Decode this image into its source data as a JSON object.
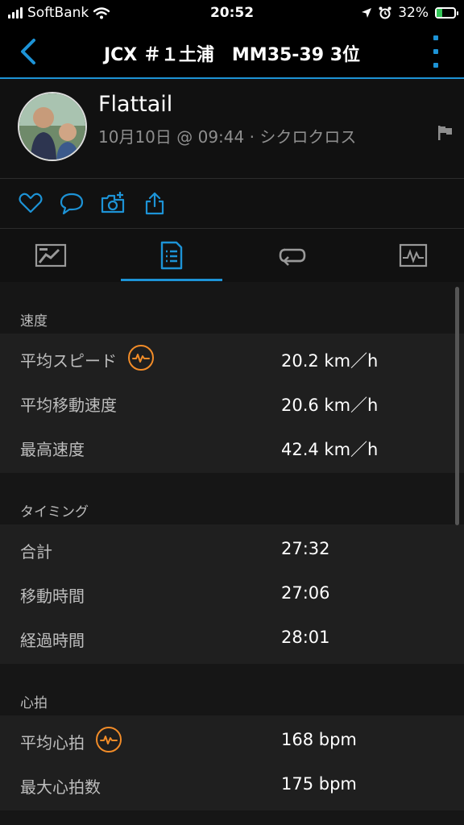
{
  "status_bar": {
    "carrier": "SoftBank",
    "time": "20:52",
    "battery": "32%",
    "battery_level": 0.32
  },
  "header": {
    "title": "JCX ＃１土浦　MM35-39 3位"
  },
  "profile": {
    "name": "Flattail",
    "meta": "10月10日 @ 09:44 · シクロクロス"
  },
  "colors": {
    "accent": "#1d93d6",
    "hr_badge": "#f28c28"
  },
  "sections": [
    {
      "title": "速度",
      "rows": [
        {
          "label": "平均スピード",
          "value": "20.2 km／h",
          "icon": "heart-rate-badge-icon"
        },
        {
          "label": "平均移動速度",
          "value": "20.6 km／h"
        },
        {
          "label": "最高速度",
          "value": "42.4 km／h"
        }
      ]
    },
    {
      "title": "タイミング",
      "rows": [
        {
          "label": "合計",
          "value": "27:32"
        },
        {
          "label": "移動時間",
          "value": "27:06"
        },
        {
          "label": "経過時間",
          "value": "28:01"
        }
      ]
    },
    {
      "title": "心拍",
      "rows": [
        {
          "label": "平均心拍",
          "value": "168 bpm",
          "icon": "heart-rate-badge-icon"
        },
        {
          "label": "最大心拍数",
          "value": "175 bpm"
        }
      ]
    }
  ]
}
